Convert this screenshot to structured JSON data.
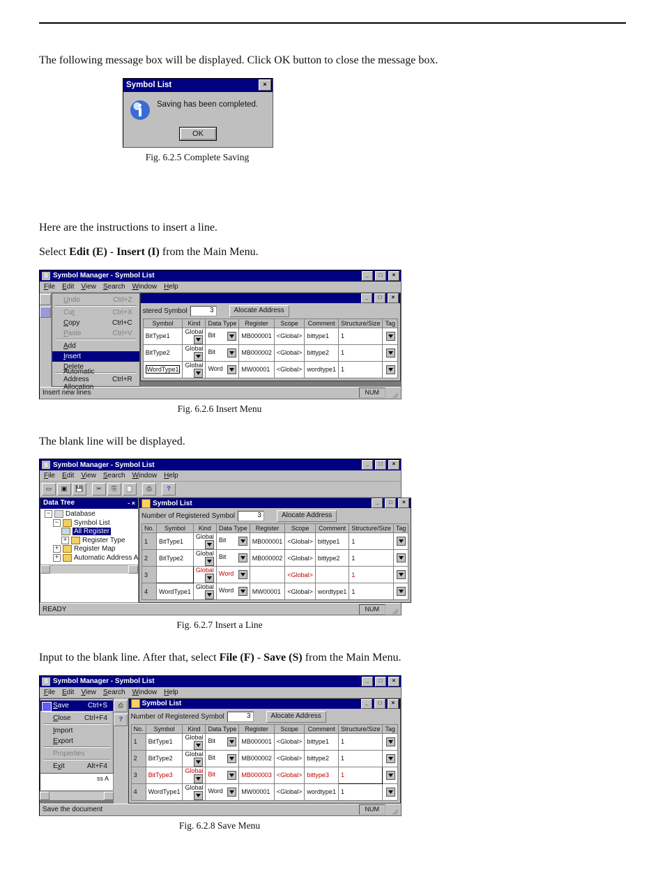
{
  "p1": "The following message box will be displayed. Click OK button to close the message box.",
  "dlg": {
    "title": "Symbol List",
    "msg": "Saving has been completed.",
    "ok": "OK",
    "close": "×"
  },
  "cap1": "Fig. 6.2.5  Complete Saving",
  "p2": "Here are the instructions to insert a line.",
  "p3_a": "Select ",
  "p3_b": "Edit (E)",
  "p3_c": " - ",
  "p3_d": "Insert (I)",
  "p3_e": " from the Main Menu.",
  "app": {
    "title": "Symbol Manager - Symbol List",
    "menus": [
      "File",
      "Edit",
      "View",
      "Search",
      "Window",
      "Help"
    ],
    "wnd": {
      "min": "_",
      "max": "□",
      "close": "×"
    }
  },
  "editmenu": {
    "undo": {
      "label": "Undo",
      "sc": "Ctrl+Z"
    },
    "cut": {
      "label": "Cut",
      "sc": "Ctrl+X"
    },
    "copy": {
      "label": "Copy",
      "sc": "Ctrl+C"
    },
    "paste": {
      "label": "Paste",
      "sc": "Ctrl+V"
    },
    "add": {
      "label": "Add",
      "sc": ""
    },
    "insert": {
      "label": "Insert",
      "sc": ""
    },
    "delete": {
      "label": "Delete",
      "sc": ""
    },
    "aaa": {
      "label": "Automatic Address Allocation",
      "sc": "Ctrl+R"
    }
  },
  "child": {
    "title": "Symbol List",
    "countlabel_short": "stered Symbol",
    "countlabel": "Number of  Registered Symbol",
    "count": "3",
    "alloc": "Alocate Address"
  },
  "cols": {
    "no": "No.",
    "symbol": "Symbol",
    "kind": "Kind",
    "dtype": "Data Type",
    "reg": "Register",
    "scope": "Scope",
    "comment": "Comment",
    "ssize": "Structure/Size",
    "tag": "Tag"
  },
  "rows3": [
    {
      "symbol": "BitType1",
      "kind": "Global",
      "dtype": "Bit",
      "reg": "MB000001",
      "scope": "<Global>",
      "comment": "bittype1",
      "ssize": "1"
    },
    {
      "symbol": "BitType2",
      "kind": "Global",
      "dtype": "Bit",
      "reg": "MB000002",
      "scope": "<Global>",
      "comment": "bittype2",
      "ssize": "1"
    },
    {
      "symbol": "WordType1",
      "kind": "Global",
      "dtype": "Word",
      "reg": "MW00001",
      "scope": "<Global>",
      "comment": "wordtype1",
      "ssize": "1"
    }
  ],
  "status3": "Insert new lines",
  "num": "NUM",
  "cap3": "Fig. 6.2.6  Insert Menu",
  "p4": "The blank line will be displayed.",
  "tree": {
    "title": "Data Tree",
    "nodes": {
      "db": "Database",
      "sl": "Symbol List",
      "ar": "All Register",
      "rt": "Register Type",
      "rm": "Register Map",
      "aaa": "Automatic Address A"
    }
  },
  "rows4": [
    {
      "no": "1",
      "symbol": "BitType1",
      "kind": "Global",
      "dtype": "Bit",
      "reg": "MB000001",
      "scope": "<Global>",
      "comment": "bittype1",
      "ssize": "1"
    },
    {
      "no": "2",
      "symbol": "BitType2",
      "kind": "Global",
      "dtype": "Bit",
      "reg": "MB000002",
      "scope": "<Global>",
      "comment": "bittype2",
      "ssize": "1"
    },
    {
      "no": "3",
      "symbol": "",
      "kind": "Global",
      "dtype": "Word",
      "reg": "",
      "scope": "<Global>",
      "comment": "",
      "ssize": "1",
      "insert": true
    },
    {
      "no": "4",
      "symbol": "WordType1",
      "kind": "Global",
      "dtype": "Word",
      "reg": "MW00001",
      "scope": "<Global>",
      "comment": "wordtype1",
      "ssize": "1"
    }
  ],
  "status4": "READY",
  "cap4": "Fig. 6.2.7  Insert a Line",
  "p5_a": "Input to the blank line. After that, select ",
  "p5_b": "File (F)",
  "p5_c": " - ",
  "p5_d": "Save (S)",
  "p5_e": " from the Main Menu.",
  "filemenu": {
    "save": {
      "label": "Save",
      "sc": "Ctrl+S"
    },
    "close": {
      "label": "Close",
      "sc": "Ctrl+F4"
    },
    "import": {
      "label": "Import",
      "sc": ""
    },
    "export": {
      "label": "Export",
      "sc": ""
    },
    "props": {
      "label": "Properties",
      "sc": ""
    },
    "exit": {
      "label": "Exit",
      "sc": "Alt+F4"
    }
  },
  "rows5": [
    {
      "no": "1",
      "symbol": "BitType1",
      "kind": "Global",
      "dtype": "Bit",
      "reg": "MB000001",
      "scope": "<Global>",
      "comment": "bittype1",
      "ssize": "1"
    },
    {
      "no": "2",
      "symbol": "BitType2",
      "kind": "Global",
      "dtype": "Bit",
      "reg": "MB000002",
      "scope": "<Global>",
      "comment": "bittype2",
      "ssize": "1"
    },
    {
      "no": "3",
      "symbol": "BitType3",
      "kind": "Global",
      "dtype": "Bit",
      "reg": "MB000003",
      "scope": "<Global>",
      "comment": "bittype3",
      "ssize": "1",
      "new": true
    },
    {
      "no": "4",
      "symbol": "WordType1",
      "kind": "Global",
      "dtype": "Word",
      "reg": "MW00001",
      "scope": "<Global>",
      "comment": "wordtype1",
      "ssize": "1"
    }
  ],
  "status5": "Save the document",
  "cap5": "Fig. 6.2.8  Save Menu",
  "tree_frag": "ss A"
}
